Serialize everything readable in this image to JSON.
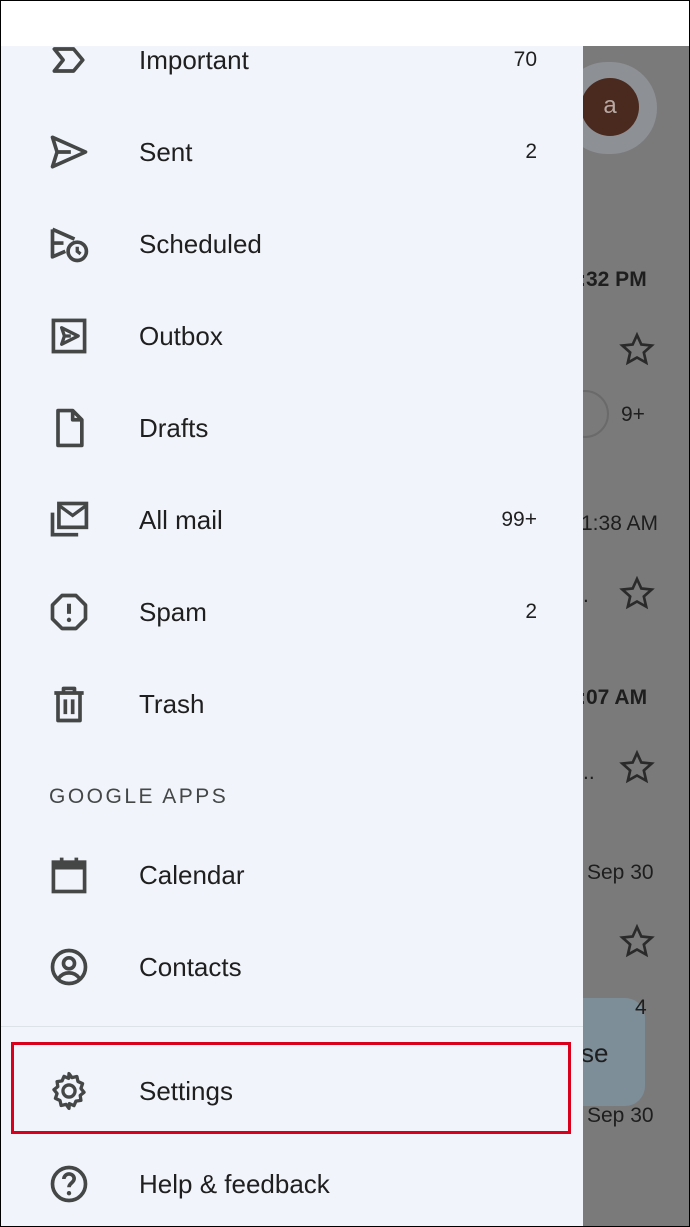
{
  "drawer": {
    "items": [
      {
        "label": "Important",
        "count": "70",
        "icon": "label-important-icon"
      },
      {
        "label": "Sent",
        "count": "2",
        "icon": "send-icon"
      },
      {
        "label": "Scheduled",
        "count": "",
        "icon": "schedule-send-icon"
      },
      {
        "label": "Outbox",
        "count": "",
        "icon": "outbox-icon"
      },
      {
        "label": "Drafts",
        "count": "",
        "icon": "draft-icon"
      },
      {
        "label": "All mail",
        "count": "99+",
        "icon": "all-mail-icon"
      },
      {
        "label": "Spam",
        "count": "2",
        "icon": "spam-icon"
      },
      {
        "label": "Trash",
        "count": "",
        "icon": "trash-icon"
      }
    ],
    "section_header": "GOOGLE APPS",
    "apps": [
      {
        "label": "Calendar",
        "icon": "calendar-icon"
      },
      {
        "label": "Contacts",
        "icon": "contacts-icon"
      }
    ],
    "settings": {
      "label": "Settings",
      "icon": "gear-icon"
    },
    "help": {
      "label": "Help & feedback",
      "icon": "help-icon"
    }
  },
  "background": {
    "avatar_letter": "a",
    "times": [
      ":32 PM",
      "1:38 AM",
      ":07 AM",
      "Sep 30",
      "Sep 30"
    ],
    "snippets": [
      "9+",
      ".",
      "..",
      "4"
    ],
    "compose_fragment": "se"
  },
  "colors": {
    "drawer_bg": "#f1f4fb",
    "highlight": "#d9001b",
    "text": "#1f1f1f"
  }
}
